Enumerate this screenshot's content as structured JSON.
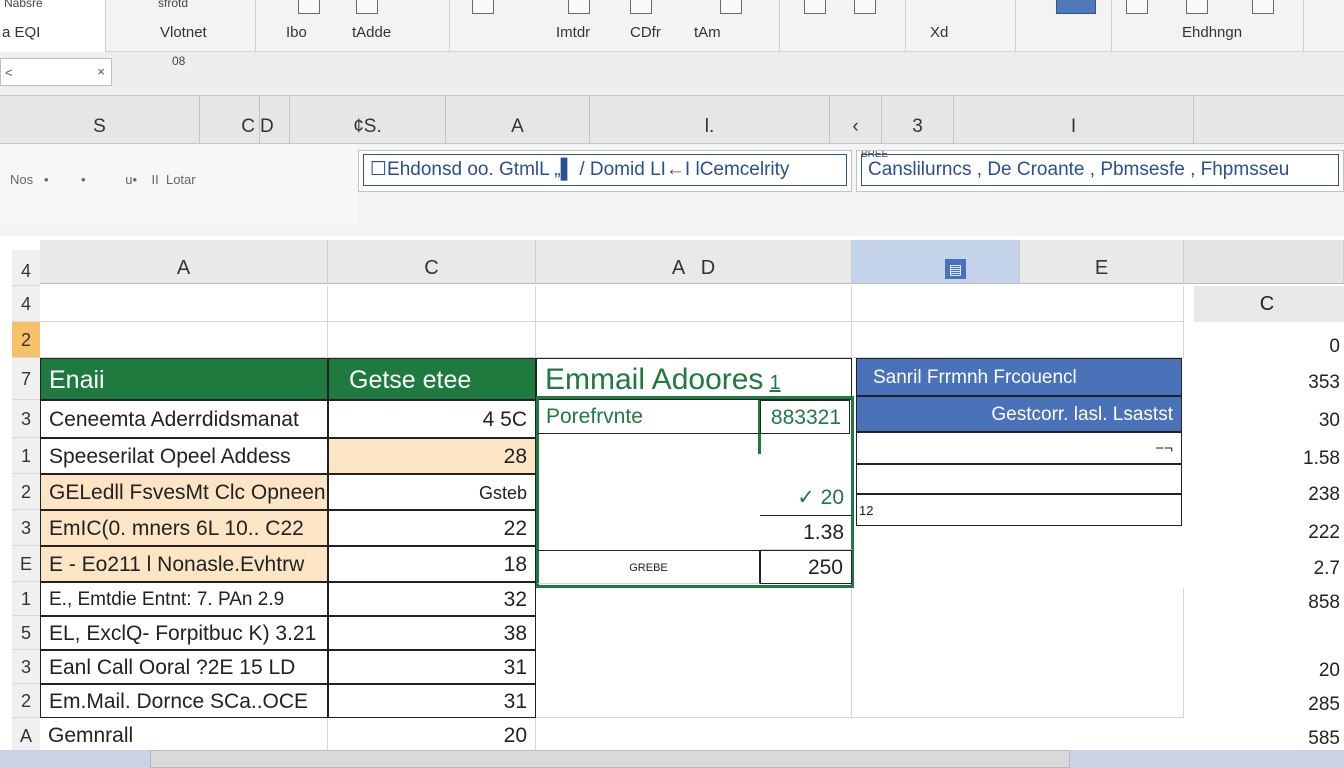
{
  "ribbon": {
    "file_label": "a  EQI",
    "file_top": "Nabsre",
    "groups": [
      "Vlotnet",
      "Ibo",
      "tAdde",
      "Imtdr",
      "CDfr",
      "tAm",
      "Xd",
      "Ehdhngn"
    ],
    "tiny_top": "sfrotd"
  },
  "namebox": {
    "label": "<",
    "close": "×",
    "extra": "08"
  },
  "upper_headers": [
    "S",
    "C",
    "D",
    "¢S.",
    "A",
    "l.",
    "‹",
    "3",
    "I"
  ],
  "formula": {
    "side_text": "Nos   •         •           u•    II  Lotar",
    "bar1": "☐Ehdonsd oo. GtmlL „▌ / Domid LI←I lCemcelrity",
    "bar2": "Canslilurncs , De Croante , Pbmsesfe , Fhpmsseu",
    "bar2_tag": "BREE"
  },
  "col_headers": [
    "A",
    "C",
    "A   D",
    "E",
    ""
  ],
  "selected_marker": "▤",
  "row_headers": [
    "4",
    "4",
    "2",
    "7",
    "3",
    "1",
    "2",
    "3",
    "E",
    "1",
    "5",
    "3",
    "2",
    "A"
  ],
  "table": {
    "header_a": "Enaii",
    "header_b": "Getse etee",
    "header_c": "Emmail Adoores",
    "header_c_mark": "1",
    "header_d": "Sanril Frrmnh Frcouencl",
    "subheader_d": "Gestcorr. lasl. Lsastst",
    "pref_label": "Porefrvnte",
    "pref_value": "883321",
    "check_value": "✓ 20",
    "val_138": "1.38",
    "val_250": "250",
    "bottom_note": "GREBE",
    "minus_mark": "−¬",
    "mark12": "12",
    "rows": [
      {
        "name": "Ceneemta Aderrdidsmanat",
        "value": "4 5C"
      },
      {
        "name": "Speeserilat Opeel Addess",
        "value": "28"
      },
      {
        "name": "GELedll FsvesMt Clc Opneen",
        "value": "Gsteb"
      },
      {
        "name": "EmIC(0. mners 6L 10.. C22",
        "value": "22"
      },
      {
        "name": "E  - Eo211 l Nonasle.Evhtrw",
        "value": "18"
      },
      {
        "name": "E.,  Emtdie Entnt: 7. PAn 2.9",
        "value": "32"
      },
      {
        "name": "EL, ExclQ- Forpitbuc K) 3.21",
        "value": "38"
      },
      {
        "name": "Eanl Call Ooral  ?2E 15 LD",
        "value": "31"
      },
      {
        "name": "Em.Mail. Dornce SCa..OCE",
        "value": "31"
      },
      {
        "name": "Gemnrall",
        "value": "20"
      }
    ]
  },
  "right_col": {
    "header": "C",
    "values": [
      "0",
      "353",
      "30",
      "1.58",
      "238",
      "222",
      "2.7",
      "858",
      "20",
      "285",
      "585"
    ]
  },
  "colors": {
    "green": "#1e7a3e",
    "blue": "#4a72b8",
    "peach": "#fbe5c5",
    "orange": "#f5c26a"
  }
}
